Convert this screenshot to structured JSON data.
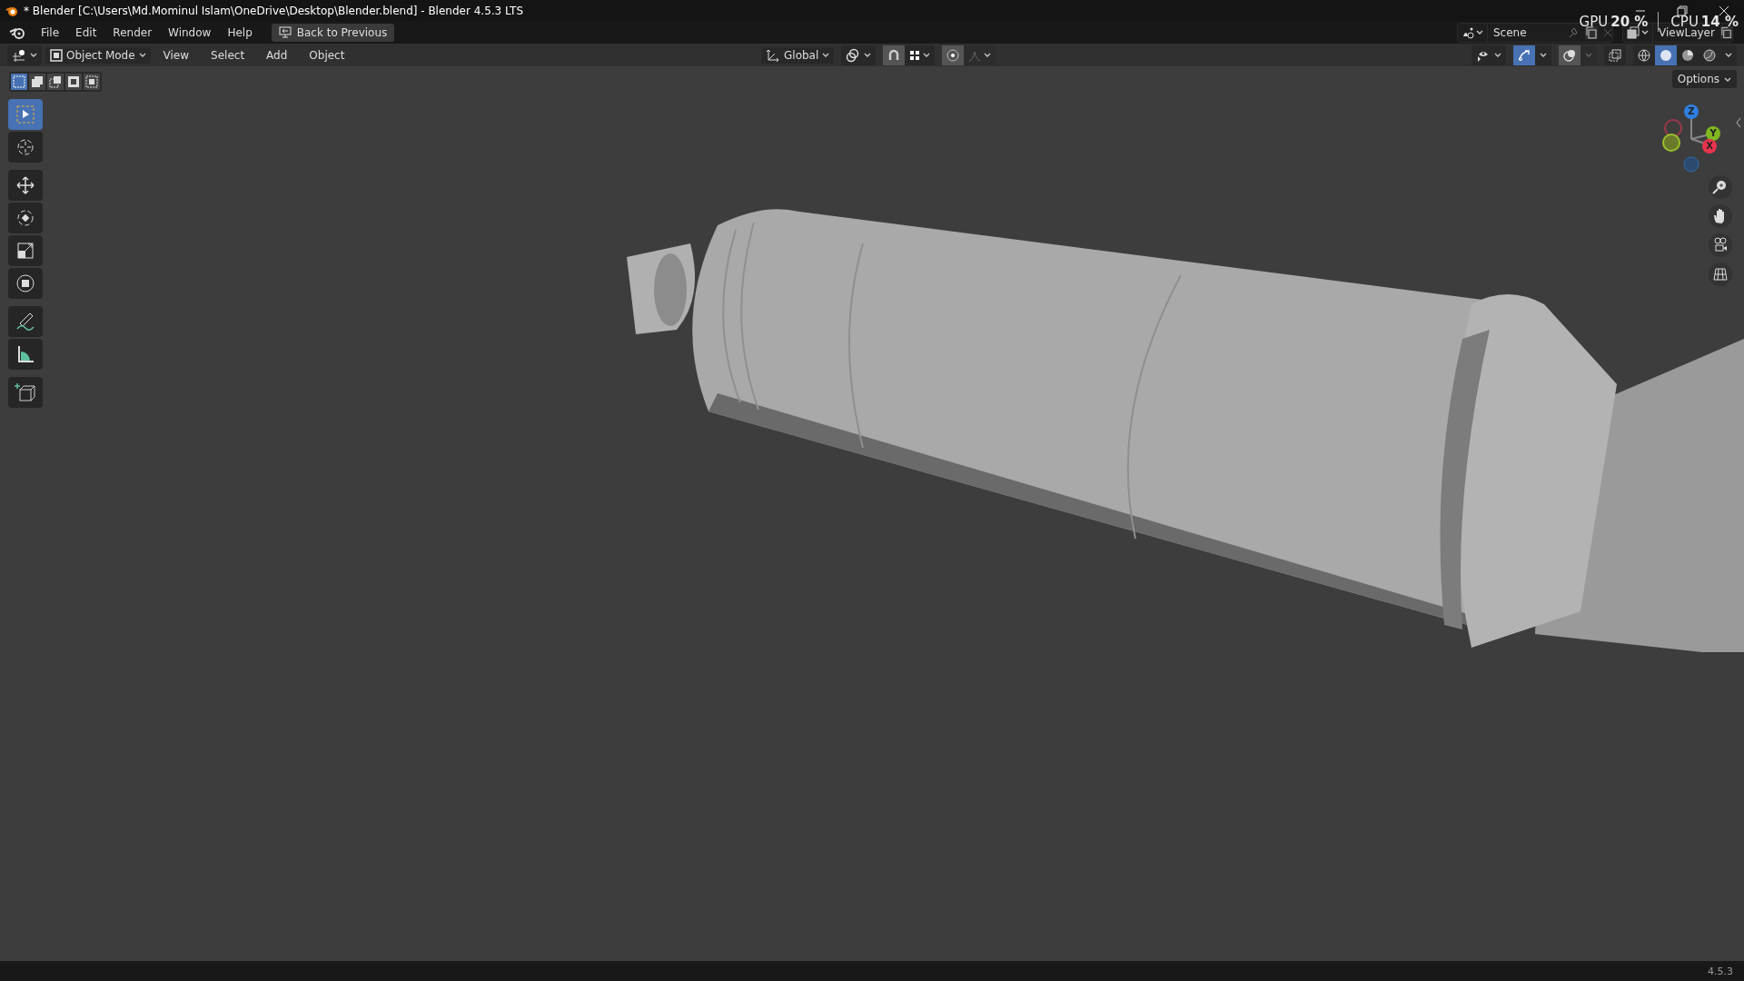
{
  "window": {
    "title": "* Blender [C:\\Users\\Md.Mominul Islam\\OneDrive\\Desktop\\Blender.blend] - Blender 4.5.3 LTS"
  },
  "menu_bar": {
    "items": [
      "File",
      "Edit",
      "Render",
      "Window",
      "Help"
    ],
    "back_button": "Back to Previous"
  },
  "scene": {
    "name": "Scene"
  },
  "view_layer": {
    "name": "ViewLayer"
  },
  "performance": [
    {
      "label": "GPU",
      "value": "20 %"
    },
    {
      "label": "CPU",
      "value": "14 %"
    }
  ],
  "header": {
    "mode": "Object Mode",
    "menus": [
      "View",
      "Select",
      "Add",
      "Object"
    ],
    "orientation": "Global",
    "snap_on": true,
    "proportional_on": true,
    "overlays_on": true,
    "shading": [
      {
        "kind": "wireframe",
        "selected": false
      },
      {
        "kind": "solid",
        "selected": true
      },
      {
        "kind": "material",
        "selected": false
      },
      {
        "kind": "rendered",
        "selected": false
      }
    ]
  },
  "select_modes": [
    {
      "kind": "new",
      "selected": true
    },
    {
      "kind": "extend",
      "selected": false
    },
    {
      "kind": "subtract",
      "selected": false
    },
    {
      "kind": "invert",
      "selected": false
    },
    {
      "kind": "intersect",
      "selected": false
    }
  ],
  "options_button": "Options",
  "tools": [
    {
      "kind": "select",
      "selected": true
    },
    {
      "kind": "cursor",
      "selected": false
    },
    {
      "kind": "move",
      "selected": false
    },
    {
      "kind": "rotate",
      "selected": false
    },
    {
      "kind": "scale",
      "selected": false
    },
    {
      "kind": "transform",
      "selected": false
    },
    {
      "kind": "annotate",
      "selected": false
    },
    {
      "kind": "measure",
      "selected": false
    },
    {
      "kind": "add-cube",
      "selected": false
    }
  ],
  "gizmo_axes": [
    {
      "label": "Z",
      "color": "#2f7fe0"
    },
    {
      "label": "Y",
      "color": "#7fb81f"
    },
    {
      "label": "X",
      "color": "#e8344e"
    }
  ],
  "status_bar": {
    "version": "4.5.3"
  }
}
